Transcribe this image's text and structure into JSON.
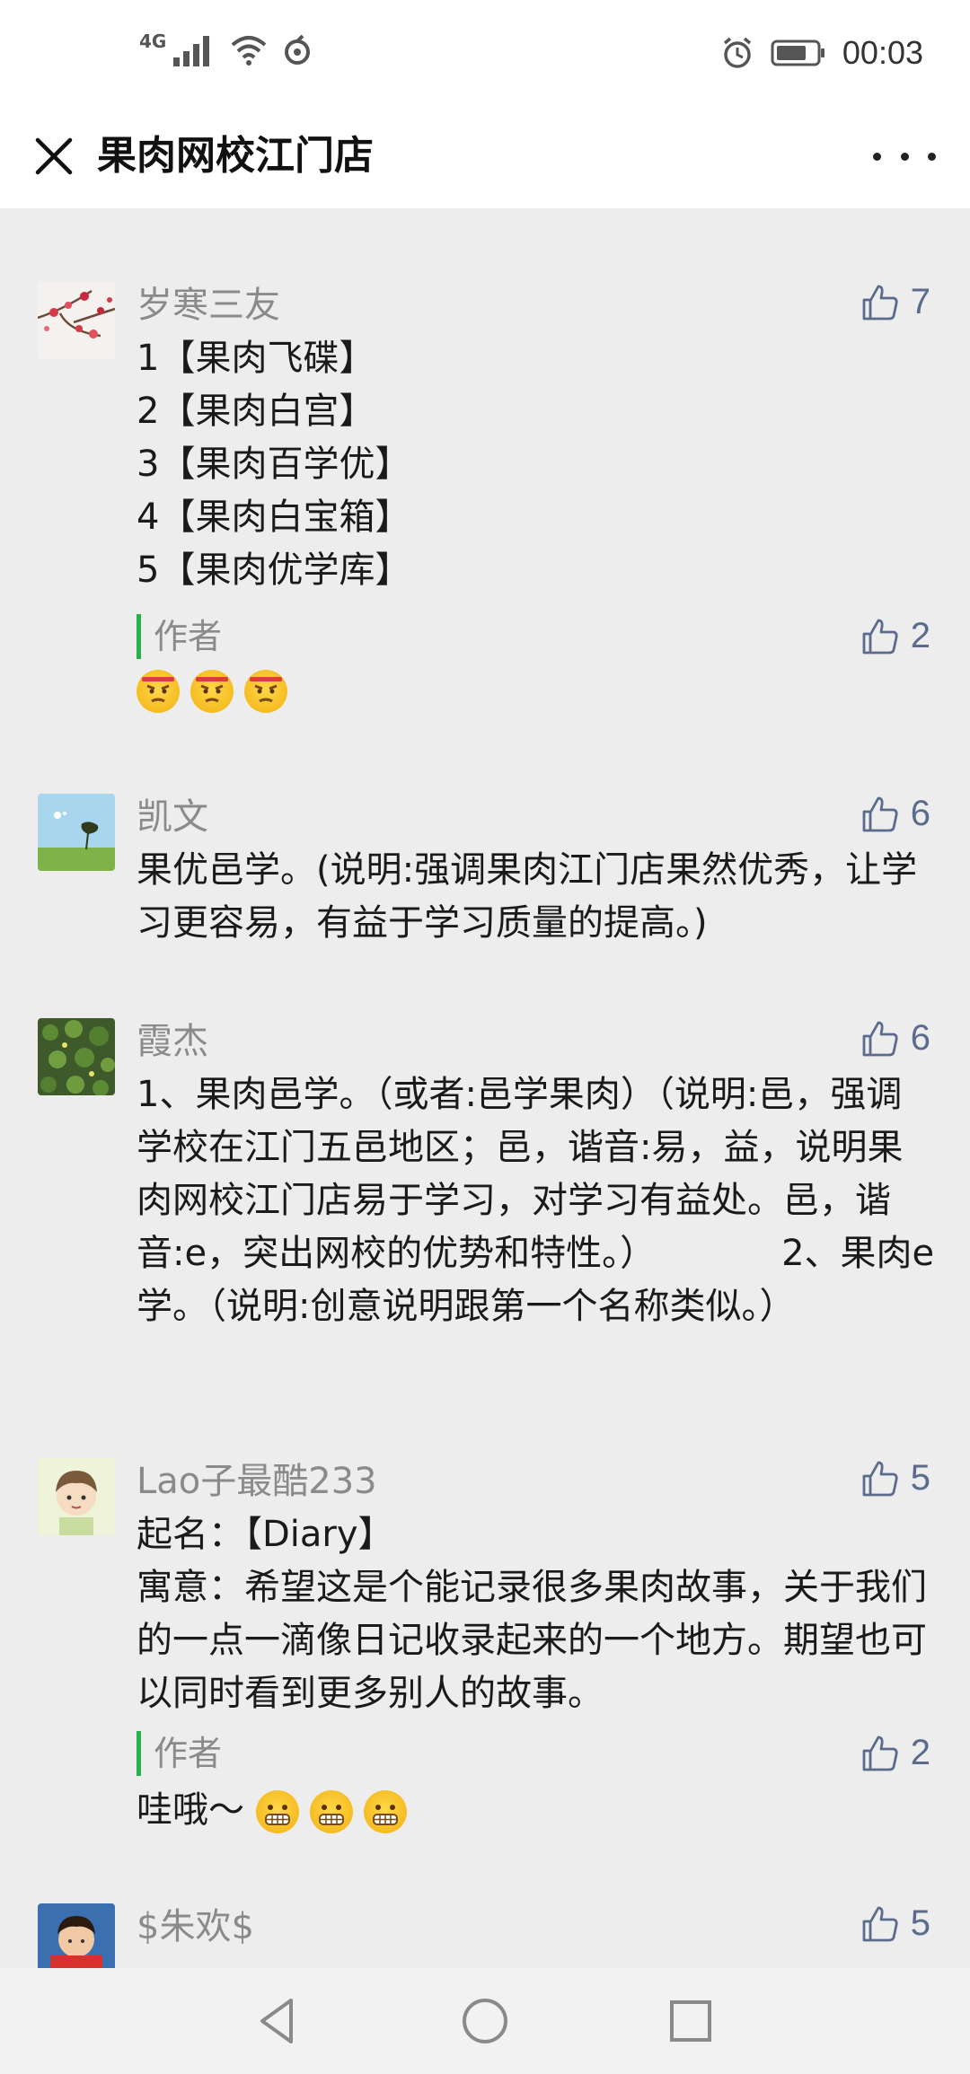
{
  "status_bar": {
    "network": "4G",
    "time": "00:03"
  },
  "header": {
    "title": "果肉网校江门店",
    "close_icon": "close-icon",
    "more_icon": "more-icon"
  },
  "comments": [
    {
      "name": "岁寒三友",
      "likes": "7",
      "text": "1【果肉飞碟】\n2【果肉白宫】\n3【果肉百学优】\n4【果肉白宝箱】\n5【果肉优学库】",
      "reply": {
        "label": "作者",
        "likes": "2",
        "text": ""
      }
    },
    {
      "name": "凯文",
      "likes": "6",
      "text": "果优邑学。(说明:强调果肉江门店果然优秀，让学习更容易，有益于学习质量的提高。)"
    },
    {
      "name": "霞杰",
      "likes": "6",
      "text": "1、果肉邑学。（或者:邑学果肉）（说明:邑，强调学校在江门五邑地区；邑，谐音:易，益，说明果肉网校江门店易于学习，对学习有益处。邑，谐音:e，突出网校的优势和特性。）　　　　2、果肉e学。（说明:创意说明跟第一个名称类似。）"
    },
    {
      "name": "Lao子最酷233",
      "likes": "5",
      "text": "起名：【Diary】\n寓意：希望这是个能记录很多果肉故事，关于我们的一点一滴像日记收录起来的一个地方。期望也可以同时看到更多别人的故事。",
      "reply": {
        "label": "作者",
        "likes": "2",
        "text": "哇哦～"
      }
    },
    {
      "name": "$朱欢$",
      "likes": "5",
      "text": ""
    }
  ],
  "colors": {
    "page_bg": "#ededed",
    "name_gray": "#8a8a8a",
    "author_bar": "#23b34a",
    "like_blue": "#5b6b8c"
  },
  "nav": {
    "back_icon": "back-triangle-icon",
    "home_icon": "home-circle-icon",
    "recents_icon": "recents-square-icon"
  }
}
